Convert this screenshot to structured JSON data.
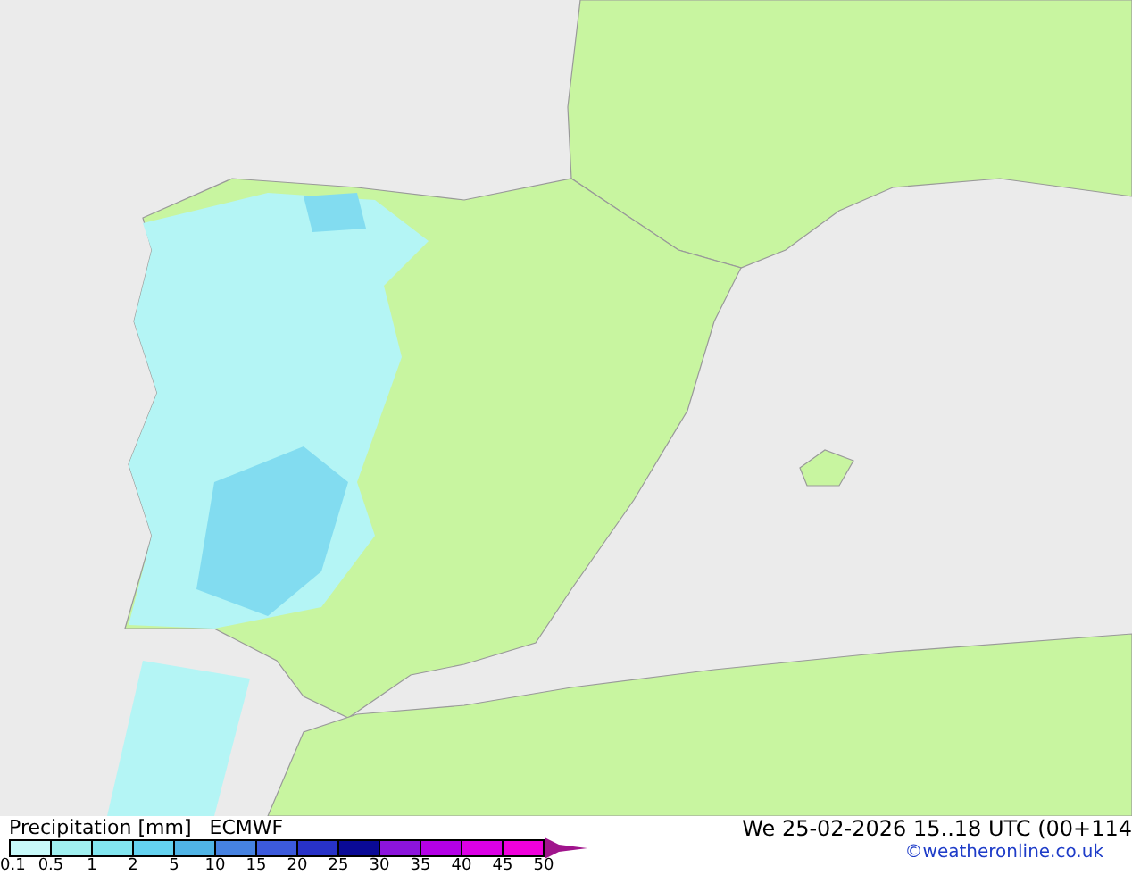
{
  "legend": {
    "title": "Precipitation [mm]",
    "model": "ECMWF",
    "swatches": [
      {
        "color": "#c8fafa"
      },
      {
        "color": "#a0f0f0"
      },
      {
        "color": "#82e6f0"
      },
      {
        "color": "#64d2f0"
      },
      {
        "color": "#50b4e6"
      },
      {
        "color": "#4682e1"
      },
      {
        "color": "#3c5adc"
      },
      {
        "color": "#2832c8"
      },
      {
        "color": "#0a0a96"
      },
      {
        "color": "#8c14dc"
      },
      {
        "color": "#b400e6"
      },
      {
        "color": "#dc00e6"
      },
      {
        "color": "#f000dc"
      }
    ],
    "ticks": [
      "0.1",
      "0.5",
      "1",
      "2",
      "5",
      "10",
      "15",
      "20",
      "25",
      "30",
      "35",
      "40",
      "45",
      "50"
    ]
  },
  "valid_time": "We 25-02-2026 15..18 UTC (00+114",
  "credit": "©weatheronline.co.uk"
}
